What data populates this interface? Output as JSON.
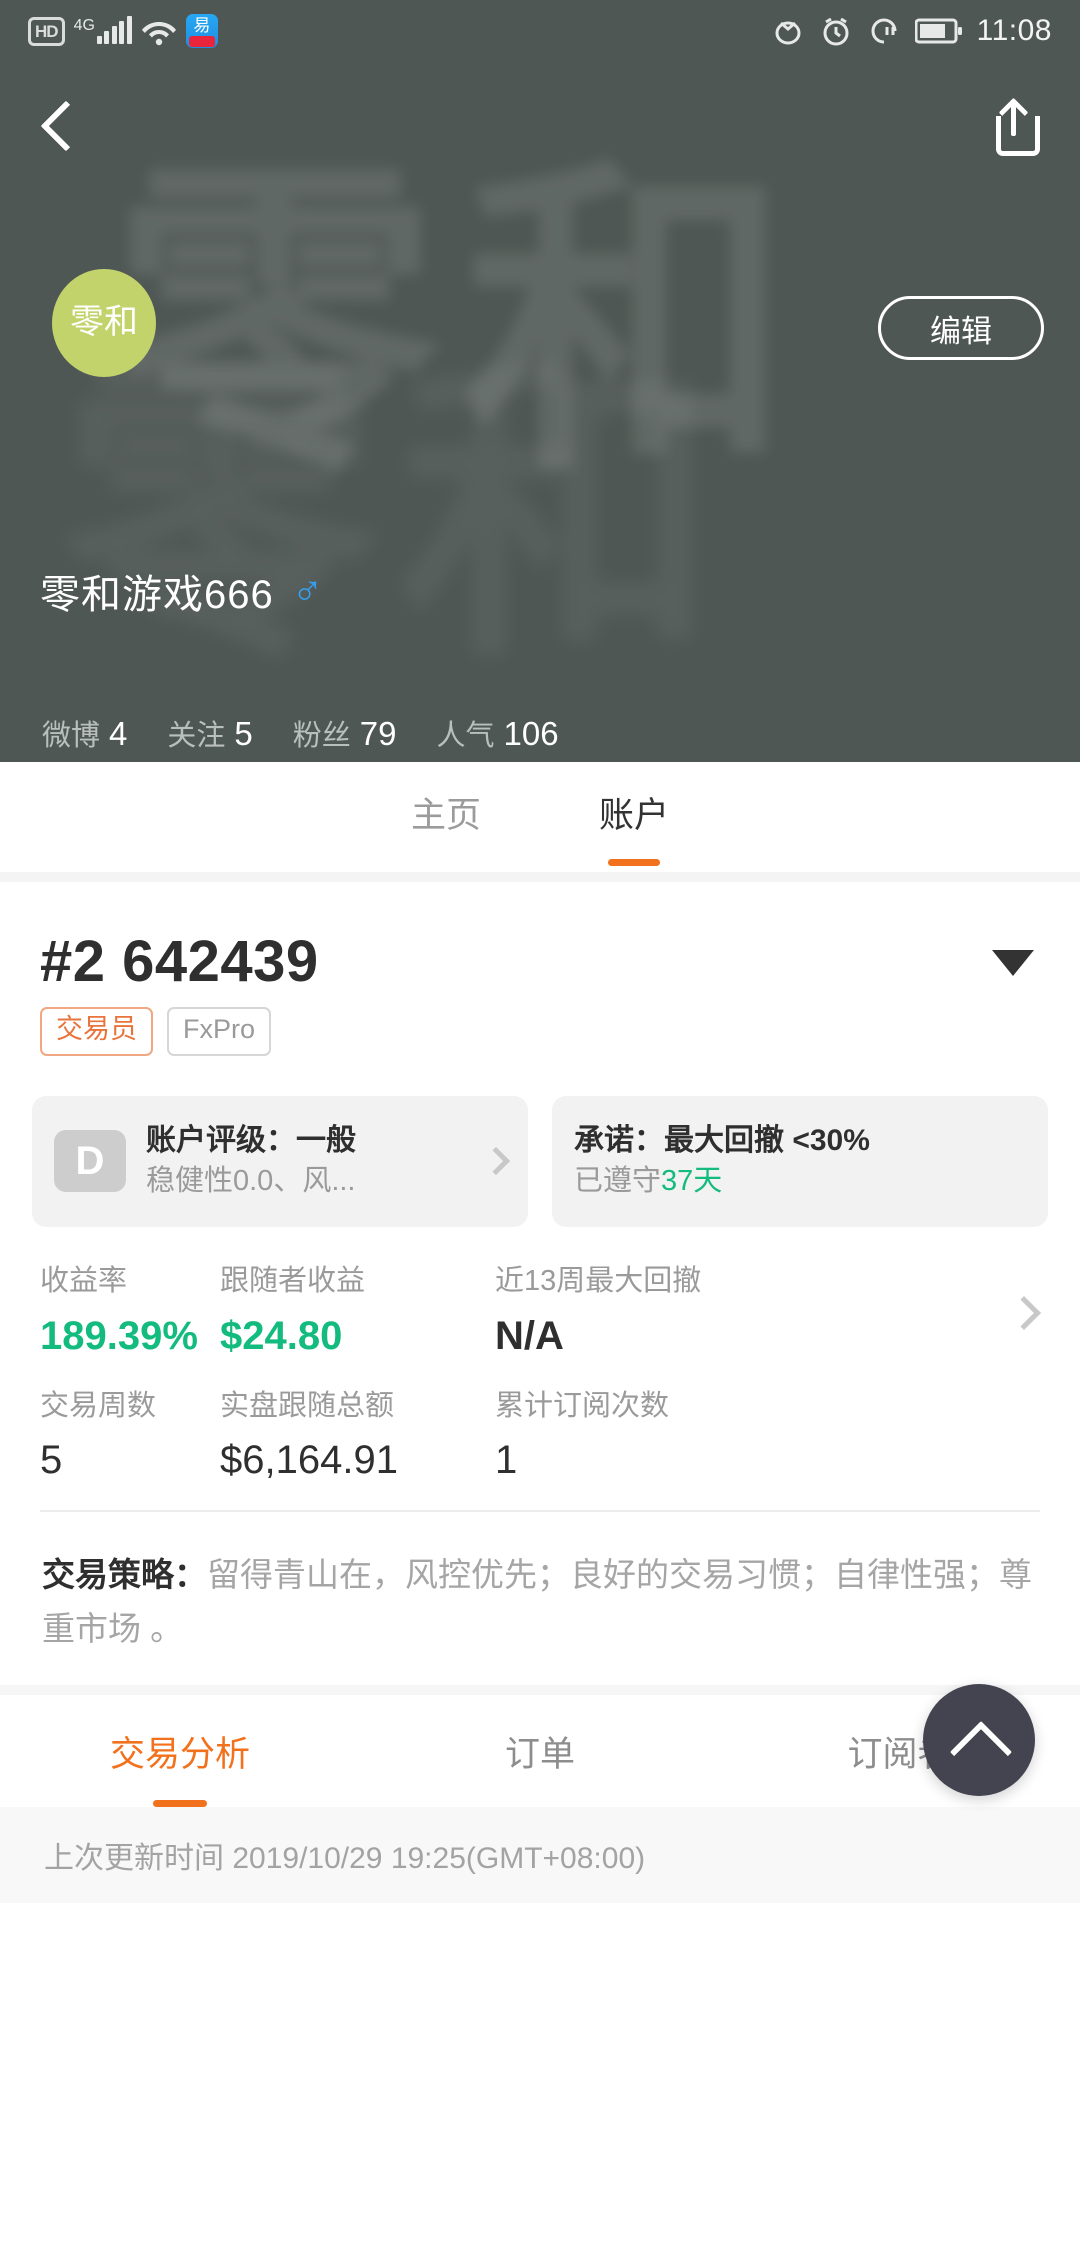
{
  "status_bar": {
    "hd_label": "HD",
    "network_label": "4G",
    "wifi_icon": "wifi-icon",
    "app_icon_glyph": "易",
    "right_icons": [
      "eye-icon",
      "alarm-clock-icon",
      "do-not-disturb-icon",
      "battery-icon"
    ],
    "time": "11:08"
  },
  "profile": {
    "back_icon": "back-arrow-icon",
    "share_icon": "share-icon",
    "watermark_text": "零和",
    "avatar_line1": "零和",
    "avatar_bg": "#c2d36c",
    "edit_label": "编辑",
    "username": "零和游戏666",
    "gender_symbol": "♂",
    "gender_color": "#34a0ef",
    "stats": [
      {
        "label": "微博",
        "value": "4"
      },
      {
        "label": "关注",
        "value": "5"
      },
      {
        "label": "粉丝",
        "value": "79"
      },
      {
        "label": "人气",
        "value": "106"
      }
    ]
  },
  "top_tabs": [
    {
      "label": "主页",
      "active": false
    },
    {
      "label": "账户",
      "active": true
    }
  ],
  "account": {
    "number": "#2 642439",
    "dropdown_icon": "chevron-down-icon",
    "tags": [
      {
        "label": "交易员",
        "color": "#e8743b"
      },
      {
        "label": "FxPro",
        "color": "#9a9a9a"
      }
    ]
  },
  "cards": [
    {
      "badge": "D",
      "title": "账户评级：一般",
      "subtitle": "稳健性0.0、风...",
      "chevron": "chevron-right-icon"
    },
    {
      "title": "承诺：最大回撤 <30%",
      "subtitle_prefix": "已遵守",
      "subtitle_highlight": "37天",
      "highlight_color": "#13bb7e"
    }
  ],
  "metrics": {
    "row1": [
      {
        "label": "收益率",
        "value": "189.39%",
        "style": "positive"
      },
      {
        "label": "跟随者收益",
        "value": "$24.80",
        "style": "positive"
      },
      {
        "label": "近13周最大回撤",
        "value": "N/A",
        "style": "normal"
      }
    ],
    "row1_chevron": "chevron-right-icon",
    "row2": [
      {
        "label": "交易周数",
        "value": "5",
        "style": "normal"
      },
      {
        "label": "实盘跟随总额",
        "value": "$6,164.91",
        "style": "normal"
      },
      {
        "label": "累计订阅次数",
        "value": "1",
        "style": "normal"
      }
    ]
  },
  "strategy": {
    "label": "交易策略：",
    "text": "留得青山在，风控优先；良好的交易习惯；自律性强；尊重市场 。"
  },
  "bottom_tabs": [
    {
      "label": "交易分析",
      "active": true
    },
    {
      "label": "订单",
      "active": false
    },
    {
      "label": "订阅者",
      "active": false
    }
  ],
  "fab": {
    "icon": "chevron-up-icon",
    "color": "#434450"
  },
  "footer": {
    "text": "上次更新时间 2019/10/29 19:25(GMT+08:00)"
  },
  "theme": {
    "header_bg": "#4f5754",
    "accent": "#f2711c",
    "positive": "#13bb7e"
  }
}
